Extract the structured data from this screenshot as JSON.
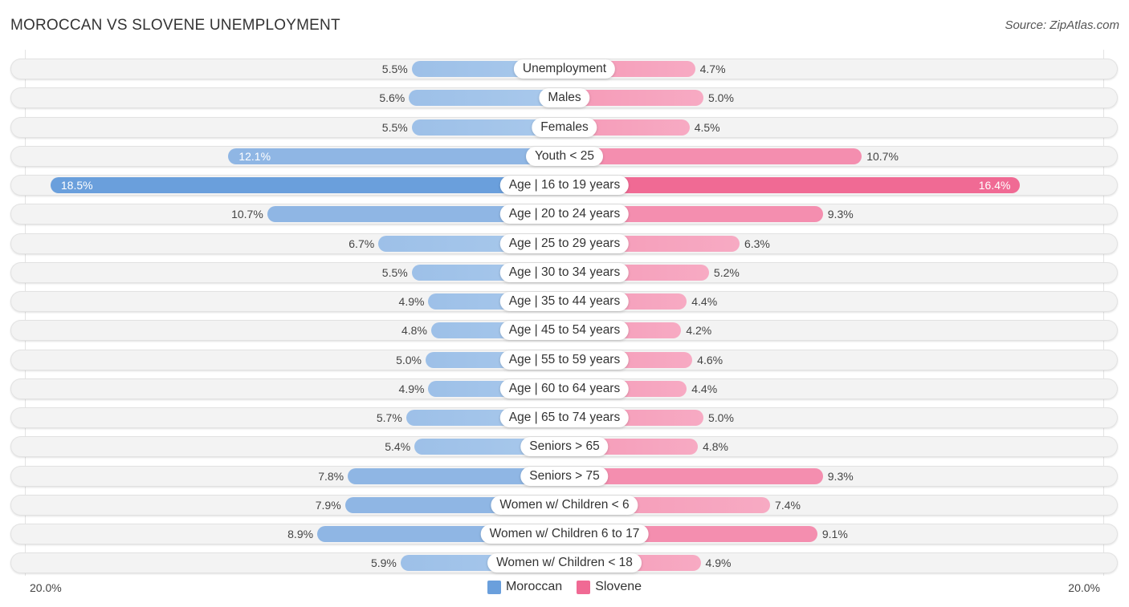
{
  "header": {
    "title": "MOROCCAN VS SLOVENE UNEMPLOYMENT",
    "source": "Source: ZipAtlas.com"
  },
  "chart_data": {
    "type": "bar",
    "orientation": "horizontal-diverging",
    "title": "MOROCCAN VS SLOVENE UNEMPLOYMENT",
    "categories": [
      "Unemployment",
      "Males",
      "Females",
      "Youth < 25",
      "Age | 16 to 19 years",
      "Age | 20 to 24 years",
      "Age | 25 to 29 years",
      "Age | 30 to 34 years",
      "Age | 35 to 44 years",
      "Age | 45 to 54 years",
      "Age | 55 to 59 years",
      "Age | 60 to 64 years",
      "Age | 65 to 74 years",
      "Seniors > 65",
      "Seniors > 75",
      "Women w/ Children < 6",
      "Women w/ Children 6 to 17",
      "Women w/ Children < 18"
    ],
    "series": [
      {
        "name": "Moroccan",
        "color": "#6a9fdc",
        "side": "left",
        "values": [
          5.5,
          5.6,
          5.5,
          12.1,
          18.5,
          10.7,
          6.7,
          5.5,
          4.9,
          4.8,
          5.0,
          4.9,
          5.7,
          5.4,
          7.8,
          7.9,
          8.9,
          5.9
        ]
      },
      {
        "name": "Slovene",
        "color": "#f06a94",
        "side": "right",
        "values": [
          4.7,
          5.0,
          4.5,
          10.7,
          16.4,
          9.3,
          6.3,
          5.2,
          4.4,
          4.2,
          4.6,
          4.4,
          5.0,
          4.8,
          9.3,
          7.4,
          9.1,
          4.9
        ]
      }
    ],
    "value_suffix": "%",
    "xlim": [
      0,
      20
    ],
    "axis_labels": {
      "left": "20.0%",
      "right": "20.0%"
    },
    "legend": {
      "position": "bottom-center",
      "entries": [
        "Moroccan",
        "Slovene"
      ]
    },
    "grid": false
  }
}
